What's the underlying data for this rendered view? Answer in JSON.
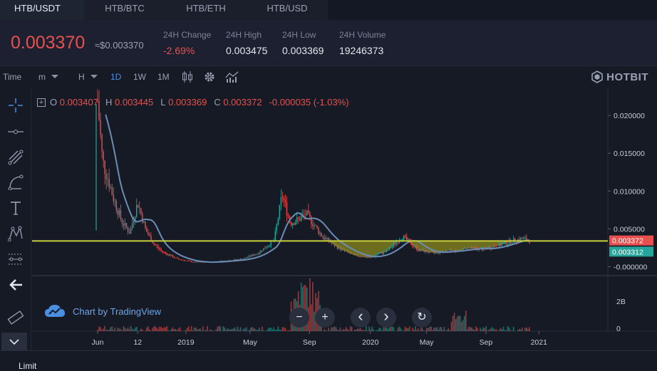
{
  "tabs": [
    {
      "label": "HTB/USDT",
      "active": true
    },
    {
      "label": "HTB/BTC"
    },
    {
      "label": "HTB/ETH"
    },
    {
      "label": "HTB/USD"
    }
  ],
  "ticker": {
    "price": "0.003370",
    "price_usd": "≈$0.003370",
    "change_label": "24H Change",
    "change_value": "-2.69%",
    "high_label": "24H High",
    "high_value": "0.003475",
    "low_label": "24H Low",
    "low_value": "0.003369",
    "volume_label": "24H Volume",
    "volume_value": "19246373"
  },
  "toolbar": {
    "time_label": "Time",
    "minute_label": "m",
    "hour_label": "H",
    "intervals": [
      "1D",
      "1W",
      "1M"
    ],
    "active_interval": "1D",
    "brand": "HOTBIT"
  },
  "legend": {
    "o_label": "O",
    "o_value": "0.003407",
    "h_label": "H",
    "h_value": "0.003445",
    "l_label": "L",
    "l_value": "0.003369",
    "c_label": "C",
    "c_value": "0.003372",
    "change": "-0.000035 (-1.03%)"
  },
  "tradingview_label": "Chart by TradingView",
  "nav": {
    "zoom_out": "−",
    "zoom_in": "+",
    "left": "‹",
    "right": "›",
    "reset": "↻"
  },
  "bottom_tab": "Limit",
  "colors": {
    "up": "#26a69a",
    "down": "#e8504f",
    "ma": "#6b8db5",
    "accent": "#4a90e2",
    "hline": "#c8cf3c",
    "cup": "#8a8a1e"
  },
  "chart_data": {
    "type": "line",
    "title": "",
    "ylabel": "",
    "xlabel": "",
    "y_ticks": [
      "0.020000",
      "0.015000",
      "0.010000",
      "0.005000",
      "-0.000000"
    ],
    "y_tick_values": [
      0.02,
      0.015,
      0.01,
      0.005,
      0.0
    ],
    "x_ticks": [
      "Jun",
      "12",
      "2019",
      "May",
      "Sep",
      "2020",
      "May",
      "Sep",
      "2021"
    ],
    "ylim": [
      -0.0008,
      0.0235
    ],
    "volume_ticks": [
      "2B",
      "0"
    ],
    "price_labels": [
      {
        "text": "0.003372",
        "value": 0.003372,
        "color": "#e8504f"
      },
      {
        "text": "0.003312",
        "value": 0.003312,
        "color": "#26a69a"
      }
    ],
    "horizontal_line": 0.0034,
    "series": [
      {
        "name": "",
        "x_positions_months": [
          0,
          0.3,
          0.6,
          1,
          1.5,
          2,
          2.5,
          3,
          3.5,
          4,
          4.5,
          5,
          6,
          7,
          8,
          9,
          10,
          11,
          11.5,
          12,
          12.5,
          13,
          13.5,
          14,
          15,
          16,
          17,
          17.5,
          18,
          18.5,
          19,
          20,
          21,
          22,
          22.5,
          23,
          24,
          25,
          26,
          26.5,
          27
        ],
        "values": [
          0.022,
          0.014,
          0.012,
          0.009,
          0.006,
          0.0045,
          0.0085,
          0.0048,
          0.003,
          0.002,
          0.0015,
          0.001,
          0.0006,
          0.0006,
          0.0008,
          0.001,
          0.0018,
          0.0035,
          0.0095,
          0.0058,
          0.0062,
          0.007,
          0.0055,
          0.004,
          0.0025,
          0.0015,
          0.0012,
          0.0017,
          0.002,
          0.003,
          0.004,
          0.0022,
          0.0018,
          0.0022,
          0.002,
          0.0025,
          0.0023,
          0.0028,
          0.0035,
          0.0037,
          0.0034
        ]
      }
    ]
  }
}
